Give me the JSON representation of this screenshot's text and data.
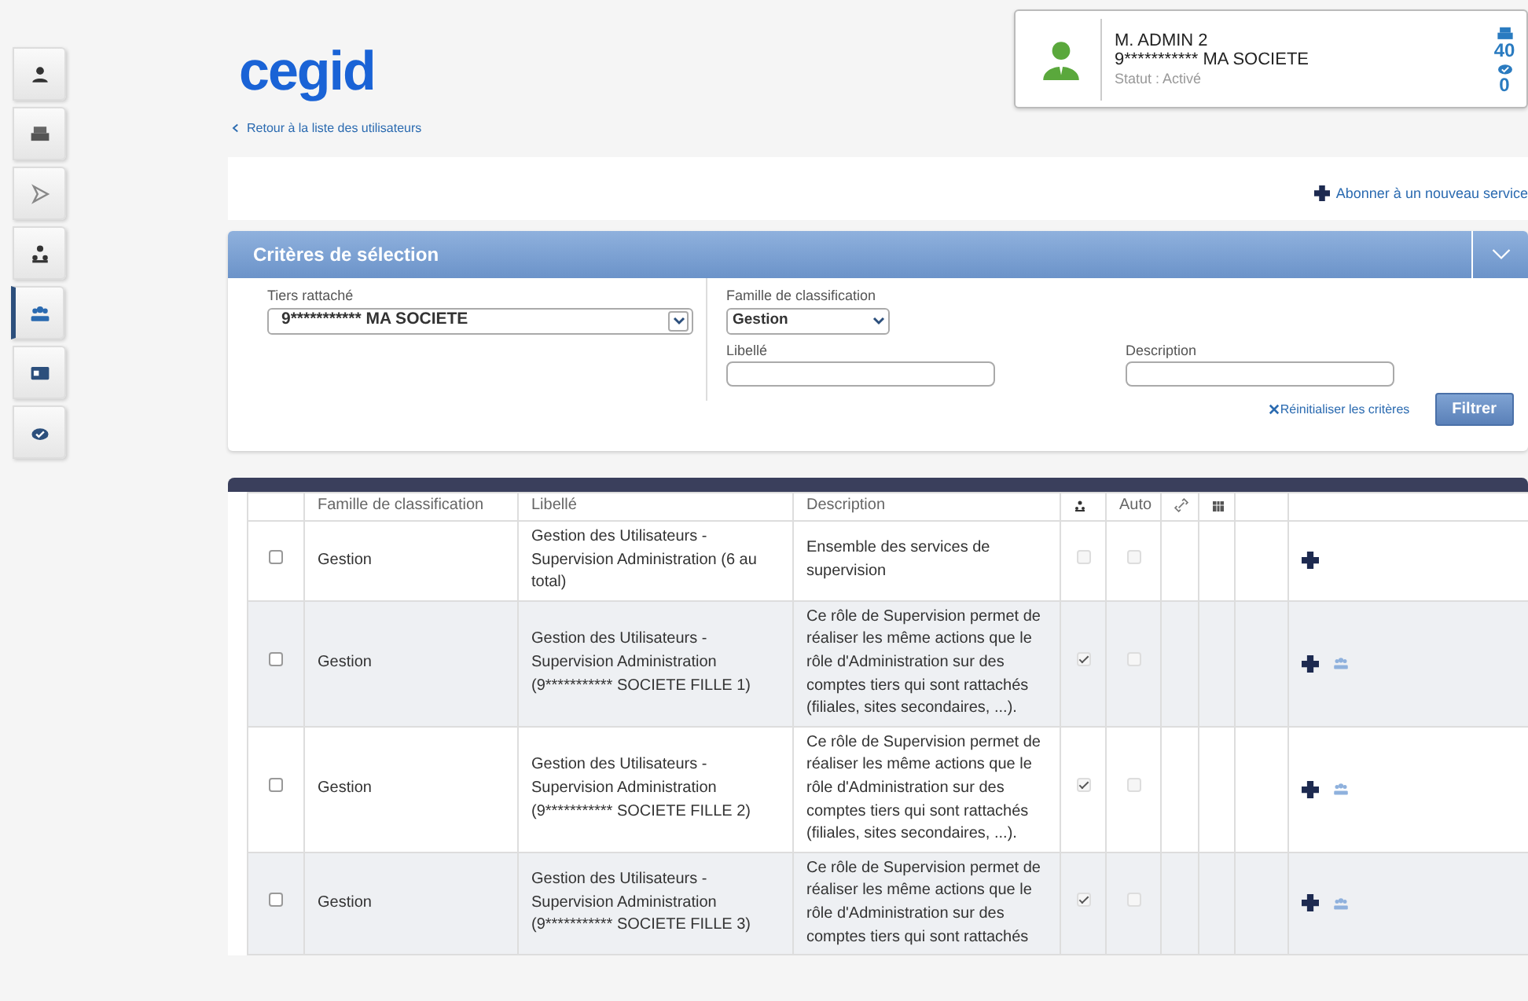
{
  "sidebar": {
    "items": [
      {
        "selected": false
      },
      {
        "selected": false
      },
      {
        "selected": false
      },
      {
        "selected": false
      },
      {
        "selected": true
      },
      {
        "selected": false
      },
      {
        "selected": false
      }
    ]
  },
  "logo": "cegid",
  "user_card": {
    "name": "M. ADMIN 2",
    "company": "9*********** MA SOCIETE",
    "status": "Statut : Activé",
    "counters": [
      {
        "value": "40"
      },
      {
        "value": "0"
      }
    ]
  },
  "back_link": "Retour à la liste des utilisateurs",
  "subscribe_link": "Abonner à un nouveau service",
  "criteria": {
    "title": "Critères de sélection",
    "expanded": true,
    "tiers": {
      "label": "Tiers rattaché",
      "value": "9*********** MA SOCIETE"
    },
    "famille": {
      "label": "Famille de classification",
      "value": "Gestion"
    },
    "libelle": {
      "label": "Libellé"
    },
    "description": {
      "label": "Description"
    },
    "reset": "Réinitialiser les critères",
    "filter_button": "Filtrer"
  },
  "table": {
    "columns": [
      "Famille de classification",
      "Libellé",
      "Description",
      "Auto"
    ],
    "rows": [
      {
        "selected": false,
        "famille": "Gestion",
        "libelle": "Gestion des Utilisateurs - Supervision Administration (6 au total)",
        "description": "Ensemble des services de supervision",
        "user_checked": false,
        "auto": false,
        "delegation": false
      },
      {
        "selected": false,
        "famille": "Gestion",
        "libelle": "Gestion des Utilisateurs - Supervision Administration (9*********** SOCIETE FILLE 1)",
        "description": "Ce rôle de Supervision permet de réaliser les même actions que le rôle d'Administration sur des comptes tiers qui sont rattachés (filiales, sites secondaires, ...).",
        "user_checked": true,
        "auto": false,
        "delegation": true
      },
      {
        "selected": false,
        "famille": "Gestion",
        "libelle": "Gestion des Utilisateurs - Supervision Administration (9*********** SOCIETE FILLE 2)",
        "description": "Ce rôle de Supervision permet de réaliser les même actions que le rôle d'Administration sur des comptes tiers qui sont rattachés (filiales, sites secondaires, ...).",
        "user_checked": true,
        "auto": false,
        "delegation": true
      },
      {
        "selected": false,
        "famille": "Gestion",
        "libelle": "Gestion des Utilisateurs - Supervision Administration (9*********** SOCIETE FILLE 3)",
        "description": "Ce rôle de Supervision permet de réaliser les même actions que le rôle d'Administration sur des comptes tiers qui sont rattachés",
        "user_checked": true,
        "auto": false,
        "delegation": true
      }
    ]
  }
}
